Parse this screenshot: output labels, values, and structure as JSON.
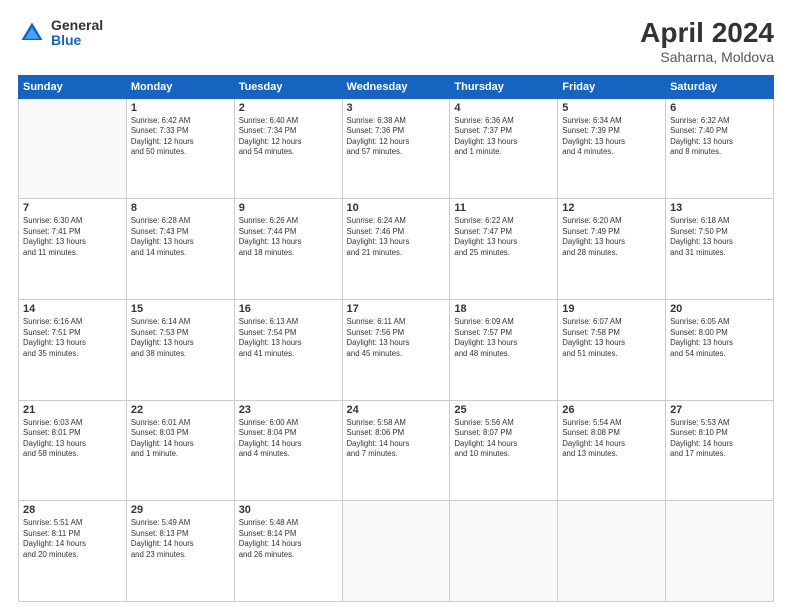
{
  "logo": {
    "general": "General",
    "blue": "Blue"
  },
  "title": "April 2024",
  "location": "Saharna, Moldova",
  "days_header": [
    "Sunday",
    "Monday",
    "Tuesday",
    "Wednesday",
    "Thursday",
    "Friday",
    "Saturday"
  ],
  "weeks": [
    [
      {
        "day": "",
        "info": ""
      },
      {
        "day": "1",
        "info": "Sunrise: 6:42 AM\nSunset: 7:33 PM\nDaylight: 12 hours\nand 50 minutes."
      },
      {
        "day": "2",
        "info": "Sunrise: 6:40 AM\nSunset: 7:34 PM\nDaylight: 12 hours\nand 54 minutes."
      },
      {
        "day": "3",
        "info": "Sunrise: 6:38 AM\nSunset: 7:36 PM\nDaylight: 12 hours\nand 57 minutes."
      },
      {
        "day": "4",
        "info": "Sunrise: 6:36 AM\nSunset: 7:37 PM\nDaylight: 13 hours\nand 1 minute."
      },
      {
        "day": "5",
        "info": "Sunrise: 6:34 AM\nSunset: 7:39 PM\nDaylight: 13 hours\nand 4 minutes."
      },
      {
        "day": "6",
        "info": "Sunrise: 6:32 AM\nSunset: 7:40 PM\nDaylight: 13 hours\nand 8 minutes."
      }
    ],
    [
      {
        "day": "7",
        "info": "Sunrise: 6:30 AM\nSunset: 7:41 PM\nDaylight: 13 hours\nand 11 minutes."
      },
      {
        "day": "8",
        "info": "Sunrise: 6:28 AM\nSunset: 7:43 PM\nDaylight: 13 hours\nand 14 minutes."
      },
      {
        "day": "9",
        "info": "Sunrise: 6:26 AM\nSunset: 7:44 PM\nDaylight: 13 hours\nand 18 minutes."
      },
      {
        "day": "10",
        "info": "Sunrise: 6:24 AM\nSunset: 7:46 PM\nDaylight: 13 hours\nand 21 minutes."
      },
      {
        "day": "11",
        "info": "Sunrise: 6:22 AM\nSunset: 7:47 PM\nDaylight: 13 hours\nand 25 minutes."
      },
      {
        "day": "12",
        "info": "Sunrise: 6:20 AM\nSunset: 7:49 PM\nDaylight: 13 hours\nand 28 minutes."
      },
      {
        "day": "13",
        "info": "Sunrise: 6:18 AM\nSunset: 7:50 PM\nDaylight: 13 hours\nand 31 minutes."
      }
    ],
    [
      {
        "day": "14",
        "info": "Sunrise: 6:16 AM\nSunset: 7:51 PM\nDaylight: 13 hours\nand 35 minutes."
      },
      {
        "day": "15",
        "info": "Sunrise: 6:14 AM\nSunset: 7:53 PM\nDaylight: 13 hours\nand 38 minutes."
      },
      {
        "day": "16",
        "info": "Sunrise: 6:13 AM\nSunset: 7:54 PM\nDaylight: 13 hours\nand 41 minutes."
      },
      {
        "day": "17",
        "info": "Sunrise: 6:11 AM\nSunset: 7:56 PM\nDaylight: 13 hours\nand 45 minutes."
      },
      {
        "day": "18",
        "info": "Sunrise: 6:09 AM\nSunset: 7:57 PM\nDaylight: 13 hours\nand 48 minutes."
      },
      {
        "day": "19",
        "info": "Sunrise: 6:07 AM\nSunset: 7:58 PM\nDaylight: 13 hours\nand 51 minutes."
      },
      {
        "day": "20",
        "info": "Sunrise: 6:05 AM\nSunset: 8:00 PM\nDaylight: 13 hours\nand 54 minutes."
      }
    ],
    [
      {
        "day": "21",
        "info": "Sunrise: 6:03 AM\nSunset: 8:01 PM\nDaylight: 13 hours\nand 58 minutes."
      },
      {
        "day": "22",
        "info": "Sunrise: 6:01 AM\nSunset: 8:03 PM\nDaylight: 14 hours\nand 1 minute."
      },
      {
        "day": "23",
        "info": "Sunrise: 6:00 AM\nSunset: 8:04 PM\nDaylight: 14 hours\nand 4 minutes."
      },
      {
        "day": "24",
        "info": "Sunrise: 5:58 AM\nSunset: 8:06 PM\nDaylight: 14 hours\nand 7 minutes."
      },
      {
        "day": "25",
        "info": "Sunrise: 5:56 AM\nSunset: 8:07 PM\nDaylight: 14 hours\nand 10 minutes."
      },
      {
        "day": "26",
        "info": "Sunrise: 5:54 AM\nSunset: 8:08 PM\nDaylight: 14 hours\nand 13 minutes."
      },
      {
        "day": "27",
        "info": "Sunrise: 5:53 AM\nSunset: 8:10 PM\nDaylight: 14 hours\nand 17 minutes."
      }
    ],
    [
      {
        "day": "28",
        "info": "Sunrise: 5:51 AM\nSunset: 8:11 PM\nDaylight: 14 hours\nand 20 minutes."
      },
      {
        "day": "29",
        "info": "Sunrise: 5:49 AM\nSunset: 8:13 PM\nDaylight: 14 hours\nand 23 minutes."
      },
      {
        "day": "30",
        "info": "Sunrise: 5:48 AM\nSunset: 8:14 PM\nDaylight: 14 hours\nand 26 minutes."
      },
      {
        "day": "",
        "info": ""
      },
      {
        "day": "",
        "info": ""
      },
      {
        "day": "",
        "info": ""
      },
      {
        "day": "",
        "info": ""
      }
    ]
  ]
}
